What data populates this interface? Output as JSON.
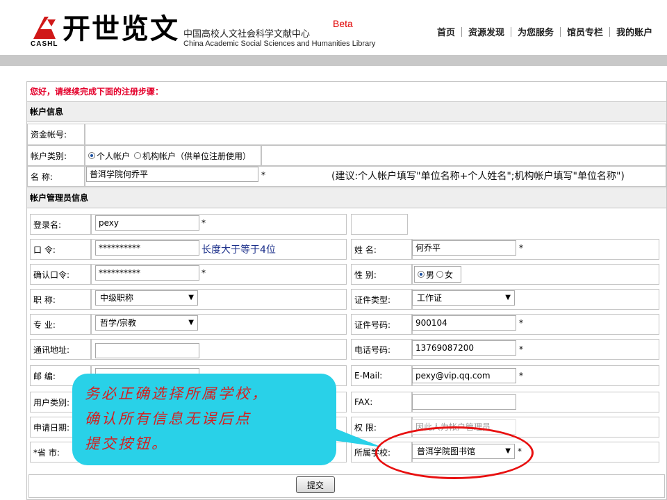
{
  "header": {
    "logo_text": "开世览文",
    "logo_sub": "CASHL",
    "org_cn": "中国高校人文社会科学文献中心",
    "org_en": "China Academic Social Sciences and Humanities Library",
    "beta": "Beta",
    "nav": [
      "首页",
      "资源发现",
      "为您服务",
      "馆员专栏",
      "我的账户"
    ]
  },
  "form": {
    "greeting": "您好，请继续完成下面的注册步骤：",
    "account_section": "帐户信息",
    "fund_account_label": "资金帐号:",
    "account_type_label": "帐户类别:",
    "account_type_personal": "个人帐户",
    "account_type_org": "机构帐户（供单位注册使用）",
    "name_label": "名 称:",
    "name_value": "普洱学院何乔平",
    "name_hint": "(建议:个人帐户填写\"单位名称+个人姓名\";机构帐户填写\"单位名称\")",
    "admin_section": "帐户管理员信息",
    "login_label": "登录名:",
    "login_value": "pexy",
    "password_label": "口 令:",
    "password_value": "**********",
    "password_hint": "长度大于等于4位",
    "confirm_label": "确认口令:",
    "confirm_value": "**********",
    "title_label": "职 称:",
    "title_value": "中级职称",
    "major_label": "专 业:",
    "major_value": "哲学/宗教",
    "address_label": "通讯地址:",
    "zip_label": "邮 编:",
    "user_type_label": "用户类别:",
    "apply_date_label": "申请日期:",
    "province_label": "*省 市:",
    "realname_label": "姓 名:",
    "realname_value": "何乔平",
    "gender_label": "性 别:",
    "gender_male": "男",
    "gender_female": "女",
    "id_type_label": "证件类型:",
    "id_type_value": "工作证",
    "id_number_label": "证件号码:",
    "id_number_value": "900104",
    "phone_label": "电话号码:",
    "phone_value": "13769087200",
    "email_label": "E-Mail:",
    "email_value": "pexy@vip.qq.com",
    "fax_label": "FAX:",
    "permission_label": "权 限:",
    "permission_value": "因此人为帐户管理员",
    "school_label": "所属学校:",
    "school_value": "普洱学院图书馆",
    "required_mark": "*",
    "submit_label": "提交"
  },
  "callout": {
    "lines": [
      "务必正确选择所属学校，",
      "确认所有信息无误后点",
      "提交按钮。"
    ]
  },
  "colors": {
    "greeting": "#e4002b",
    "callout_bg": "#29d1e8",
    "callout_text": "#d42020",
    "highlight": "#e81010"
  }
}
